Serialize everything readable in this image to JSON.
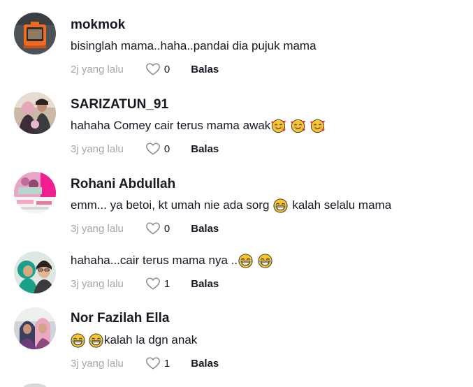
{
  "comments": [
    {
      "username": "mokmok",
      "text": "bisinglah mama..haha..pandai dia pujuk mama",
      "time": "2j yang lalu",
      "likes": "0",
      "reply_label": "Balas"
    },
    {
      "username": "SARIZATUN_91",
      "text": "hahaha Comey cair terus mama awak",
      "time": "3j yang lalu",
      "likes": "0",
      "reply_label": "Balas",
      "emojis": [
        "smiling-face-with-hearts",
        "smiling-face-with-hearts",
        "smiling-face-with-hearts"
      ]
    },
    {
      "username": "Rohani Abdullah",
      "text_before": "emm... ya betoi, kt umah nie ada sorg",
      "text_after": "kalah selalu mama",
      "time": "3j yang lalu",
      "likes": "0",
      "reply_label": "Balas",
      "emojis": [
        "face-with-tears-of-joy"
      ]
    },
    {
      "username": "",
      "text": "hahaha...cair terus mama nya ..",
      "time": "3j yang lalu",
      "likes": "1",
      "reply_label": "Balas",
      "emojis": [
        "face-with-tears-of-joy",
        "face-with-tears-of-joy"
      ]
    },
    {
      "username": "Nor Fazilah Ella",
      "text": "kalah la dgn anak",
      "time": "3j yang lalu",
      "likes": "1",
      "reply_label": "Balas",
      "emojis": [
        "face-with-tears-of-joy",
        "face-with-tears-of-joy"
      ]
    }
  ],
  "icons": {
    "like": "heart-outline-icon",
    "laugh_emoji": "face-with-tears-of-joy",
    "love_emoji": "smiling-face-with-hearts"
  },
  "colors": {
    "text": "#161823",
    "muted": "#a5a6ab",
    "heart": "#8a8b91"
  }
}
